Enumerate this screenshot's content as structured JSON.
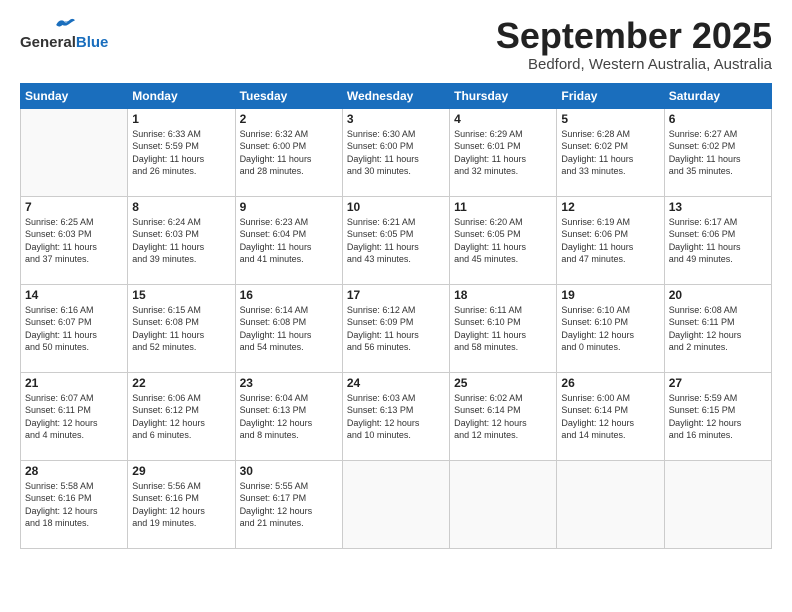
{
  "logo": {
    "general": "General",
    "blue": "Blue"
  },
  "title": "September 2025",
  "subtitle": "Bedford, Western Australia, Australia",
  "days_header": [
    "Sunday",
    "Monday",
    "Tuesday",
    "Wednesday",
    "Thursday",
    "Friday",
    "Saturday"
  ],
  "weeks": [
    [
      {
        "day": "",
        "info": ""
      },
      {
        "day": "1",
        "info": "Sunrise: 6:33 AM\nSunset: 5:59 PM\nDaylight: 11 hours\nand 26 minutes."
      },
      {
        "day": "2",
        "info": "Sunrise: 6:32 AM\nSunset: 6:00 PM\nDaylight: 11 hours\nand 28 minutes."
      },
      {
        "day": "3",
        "info": "Sunrise: 6:30 AM\nSunset: 6:00 PM\nDaylight: 11 hours\nand 30 minutes."
      },
      {
        "day": "4",
        "info": "Sunrise: 6:29 AM\nSunset: 6:01 PM\nDaylight: 11 hours\nand 32 minutes."
      },
      {
        "day": "5",
        "info": "Sunrise: 6:28 AM\nSunset: 6:02 PM\nDaylight: 11 hours\nand 33 minutes."
      },
      {
        "day": "6",
        "info": "Sunrise: 6:27 AM\nSunset: 6:02 PM\nDaylight: 11 hours\nand 35 minutes."
      }
    ],
    [
      {
        "day": "7",
        "info": "Sunrise: 6:25 AM\nSunset: 6:03 PM\nDaylight: 11 hours\nand 37 minutes."
      },
      {
        "day": "8",
        "info": "Sunrise: 6:24 AM\nSunset: 6:03 PM\nDaylight: 11 hours\nand 39 minutes."
      },
      {
        "day": "9",
        "info": "Sunrise: 6:23 AM\nSunset: 6:04 PM\nDaylight: 11 hours\nand 41 minutes."
      },
      {
        "day": "10",
        "info": "Sunrise: 6:21 AM\nSunset: 6:05 PM\nDaylight: 11 hours\nand 43 minutes."
      },
      {
        "day": "11",
        "info": "Sunrise: 6:20 AM\nSunset: 6:05 PM\nDaylight: 11 hours\nand 45 minutes."
      },
      {
        "day": "12",
        "info": "Sunrise: 6:19 AM\nSunset: 6:06 PM\nDaylight: 11 hours\nand 47 minutes."
      },
      {
        "day": "13",
        "info": "Sunrise: 6:17 AM\nSunset: 6:06 PM\nDaylight: 11 hours\nand 49 minutes."
      }
    ],
    [
      {
        "day": "14",
        "info": "Sunrise: 6:16 AM\nSunset: 6:07 PM\nDaylight: 11 hours\nand 50 minutes."
      },
      {
        "day": "15",
        "info": "Sunrise: 6:15 AM\nSunset: 6:08 PM\nDaylight: 11 hours\nand 52 minutes."
      },
      {
        "day": "16",
        "info": "Sunrise: 6:14 AM\nSunset: 6:08 PM\nDaylight: 11 hours\nand 54 minutes."
      },
      {
        "day": "17",
        "info": "Sunrise: 6:12 AM\nSunset: 6:09 PM\nDaylight: 11 hours\nand 56 minutes."
      },
      {
        "day": "18",
        "info": "Sunrise: 6:11 AM\nSunset: 6:10 PM\nDaylight: 11 hours\nand 58 minutes."
      },
      {
        "day": "19",
        "info": "Sunrise: 6:10 AM\nSunset: 6:10 PM\nDaylight: 12 hours\nand 0 minutes."
      },
      {
        "day": "20",
        "info": "Sunrise: 6:08 AM\nSunset: 6:11 PM\nDaylight: 12 hours\nand 2 minutes."
      }
    ],
    [
      {
        "day": "21",
        "info": "Sunrise: 6:07 AM\nSunset: 6:11 PM\nDaylight: 12 hours\nand 4 minutes."
      },
      {
        "day": "22",
        "info": "Sunrise: 6:06 AM\nSunset: 6:12 PM\nDaylight: 12 hours\nand 6 minutes."
      },
      {
        "day": "23",
        "info": "Sunrise: 6:04 AM\nSunset: 6:13 PM\nDaylight: 12 hours\nand 8 minutes."
      },
      {
        "day": "24",
        "info": "Sunrise: 6:03 AM\nSunset: 6:13 PM\nDaylight: 12 hours\nand 10 minutes."
      },
      {
        "day": "25",
        "info": "Sunrise: 6:02 AM\nSunset: 6:14 PM\nDaylight: 12 hours\nand 12 minutes."
      },
      {
        "day": "26",
        "info": "Sunrise: 6:00 AM\nSunset: 6:14 PM\nDaylight: 12 hours\nand 14 minutes."
      },
      {
        "day": "27",
        "info": "Sunrise: 5:59 AM\nSunset: 6:15 PM\nDaylight: 12 hours\nand 16 minutes."
      }
    ],
    [
      {
        "day": "28",
        "info": "Sunrise: 5:58 AM\nSunset: 6:16 PM\nDaylight: 12 hours\nand 18 minutes."
      },
      {
        "day": "29",
        "info": "Sunrise: 5:56 AM\nSunset: 6:16 PM\nDaylight: 12 hours\nand 19 minutes."
      },
      {
        "day": "30",
        "info": "Sunrise: 5:55 AM\nSunset: 6:17 PM\nDaylight: 12 hours\nand 21 minutes."
      },
      {
        "day": "",
        "info": ""
      },
      {
        "day": "",
        "info": ""
      },
      {
        "day": "",
        "info": ""
      },
      {
        "day": "",
        "info": ""
      }
    ]
  ]
}
